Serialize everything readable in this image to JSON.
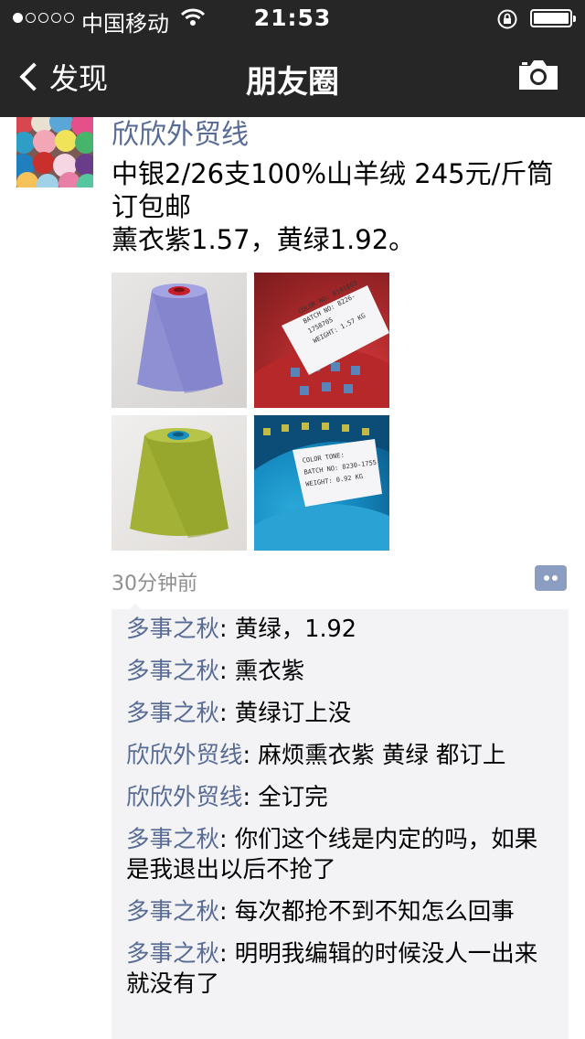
{
  "status_bar": {
    "carrier": "中国移动",
    "time": "21:53"
  },
  "nav": {
    "back_label": "发现",
    "title": "朋友圈"
  },
  "post": {
    "author": "欣欣外贸线",
    "text_lines": [
      "中银2/26支100%山羊绒 245元/斤筒订包邮",
      "薰衣紫1.57，黄绿1.92。"
    ],
    "time": "30分钟前",
    "images": [
      {
        "label_lines": [
          "COLOR NO: 8101865",
          "BATCH NO: 8226-175870S",
          "WEIGHT: 1.57 KG"
        ]
      },
      {
        "label_lines": [
          "COLOR TONE:",
          "BATCH NO: 8230-1755",
          "WEIGHT: 0.92 KG"
        ]
      }
    ]
  },
  "comments": [
    {
      "user": "多事之秋",
      "sep": ": ",
      "text": "黄绿，1.92"
    },
    {
      "user": "多事之秋",
      "sep": ": ",
      "text": "熏衣紫"
    },
    {
      "user": "多事之秋",
      "sep": ": ",
      "text": "黄绿订上没"
    },
    {
      "user": "欣欣外贸线",
      "sep": ": ",
      "text": "麻烦熏衣紫 黄绿 都订上"
    },
    {
      "user": "欣欣外贸线",
      "sep": ": ",
      "text": "全订完"
    },
    {
      "user": "多事之秋",
      "sep": ": ",
      "text": "你们这个线是内定的吗，如果是我退出以后不抢了"
    },
    {
      "user": "多事之秋",
      "sep": ": ",
      "text": "每次都抢不到不知怎么回事"
    },
    {
      "user": "多事之秋",
      "sep": ": ",
      "text": "明明我编辑的时候没人一出来就没有了"
    }
  ]
}
